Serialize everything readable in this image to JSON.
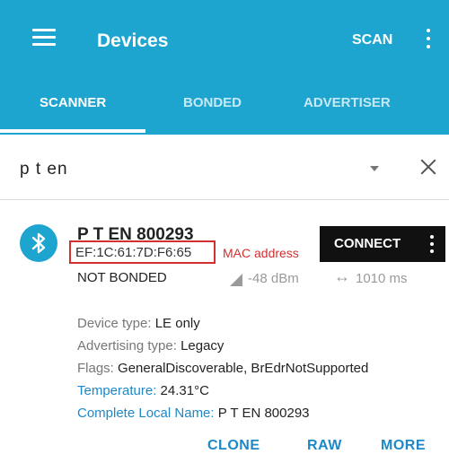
{
  "app_bar": {
    "title": "Devices",
    "scan_label": "SCAN",
    "color": "#1ea5cf"
  },
  "tabs": [
    {
      "label": "SCANNER",
      "active": true
    },
    {
      "label": "BONDED",
      "active": false
    },
    {
      "label": "ADVERTISER",
      "active": false
    }
  ],
  "filter": {
    "text": "p t en"
  },
  "device": {
    "name": "P T EN 800293",
    "mac": "EF:1C:61:7D:F6:65",
    "mac_annotation": "MAC address",
    "bond_state": "NOT BONDED",
    "rssi": "-48 dBm",
    "interval": "1010 ms",
    "connect_label": "CONNECT",
    "details": [
      {
        "key": "Device type:",
        "value": "LE only",
        "key_color": "gray"
      },
      {
        "key": "Advertising type:",
        "value": "Legacy",
        "key_color": "gray"
      },
      {
        "key": "Flags:",
        "value": "GeneralDiscoverable, BrEdrNotSupported",
        "key_color": "gray"
      },
      {
        "key": "Temperature:",
        "value": "24.31°C",
        "key_color": "blue"
      },
      {
        "key": "Complete Local Name:",
        "value": "P T EN 800293",
        "key_color": "blue"
      }
    ],
    "actions": [
      "CLONE",
      "RAW",
      "MORE"
    ]
  },
  "icons": [
    "menu-icon",
    "overflow-icon",
    "dropdown-icon",
    "clear-icon",
    "bluetooth-icon",
    "signal-icon",
    "interval-icon"
  ],
  "colors": {
    "accent": "#1ea5cf",
    "annotation": "#d32f2f",
    "link": "#1e88c7"
  }
}
